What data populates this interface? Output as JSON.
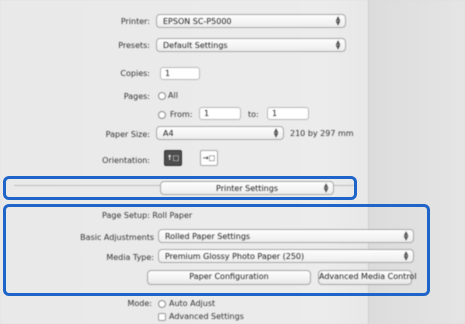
{
  "top": {
    "printer_label": "Printer:",
    "printer_value": "EPSON SC-P5000",
    "presets_label": "Presets:",
    "presets_value": "Default Settings",
    "copies_label": "Copies:",
    "copies_value": "1",
    "pages_label": "Pages:",
    "pages_all": "All",
    "pages_from": "From:",
    "from_value": "1",
    "pages_to": "to:",
    "to_value": "1",
    "paper_size_label": "Paper Size:",
    "paper_size_value": "A4",
    "paper_size_dims": "210 by 297 mm",
    "orientation_label": "Orientation:",
    "orient_portrait": "↑□",
    "orient_landscape": "→□"
  },
  "section_popup": {
    "value": "Printer Settings"
  },
  "settings": {
    "heading": "Page Setup: Roll Paper",
    "media_adjust_label": "Basic Adjustments",
    "media_adjust_value": "Rolled Paper Settings",
    "media_type_label": "Media Type:",
    "media_type_value": "Premium Glossy Photo Paper (250)",
    "btn_left": "Paper Configuration",
    "btn_right": "Advanced Media Control"
  },
  "bottom": {
    "mode_label": "Mode:",
    "mode_auto": "Auto Adjust",
    "advanced_label": "Advanced Settings"
  }
}
